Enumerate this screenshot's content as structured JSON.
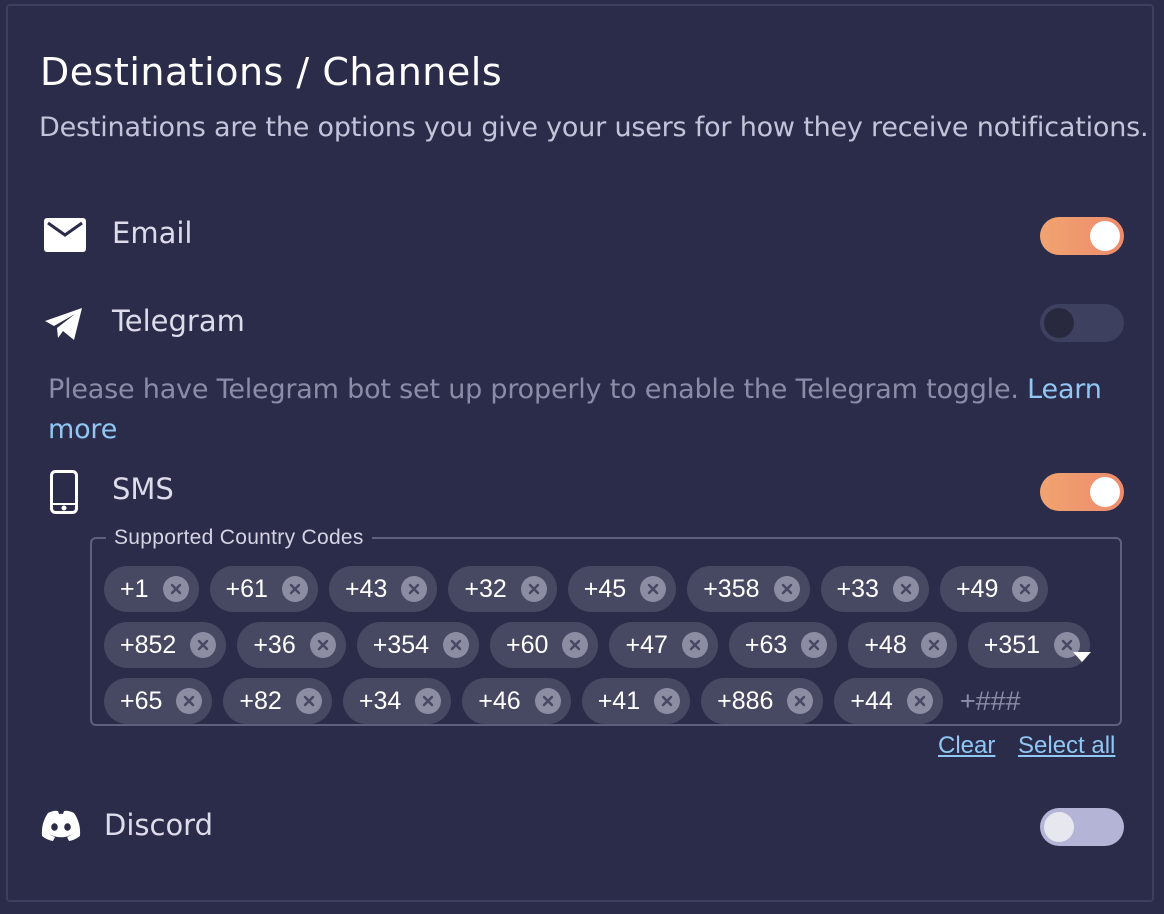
{
  "header": {
    "title": "Destinations / Channels",
    "subtitle": "Destinations are the options you give your users for how they receive notifications."
  },
  "channels": {
    "email": {
      "label": "Email",
      "icon": "mail-icon",
      "enabled": true
    },
    "telegram": {
      "label": "Telegram",
      "icon": "telegram-icon",
      "enabled": false,
      "note": "Please have Telegram bot set up properly to enable the Telegram toggle.",
      "note_link": "Learn more"
    },
    "sms": {
      "label": "SMS",
      "icon": "phone-icon",
      "enabled": true,
      "country_codes": {
        "legend": "Supported Country Codes",
        "rows": [
          [
            "+1",
            "+61",
            "+43",
            "+32",
            "+45",
            "+358",
            "+33",
            "+49"
          ],
          [
            "+852",
            "+36",
            "+354",
            "+60",
            "+47",
            "+63",
            "+48",
            "+351"
          ],
          [
            "+65",
            "+82",
            "+34",
            "+46",
            "+41",
            "+886",
            "+44"
          ]
        ],
        "input_placeholder": "+###",
        "clear_label": "Clear",
        "select_all_label": "Select all"
      }
    },
    "discord": {
      "label": "Discord",
      "icon": "discord-icon",
      "enabled": false
    }
  },
  "colors": {
    "background": "#2b2c49",
    "toggle_on": "#ee8a6c",
    "link": "#90c7f5",
    "chip": "#474862"
  }
}
